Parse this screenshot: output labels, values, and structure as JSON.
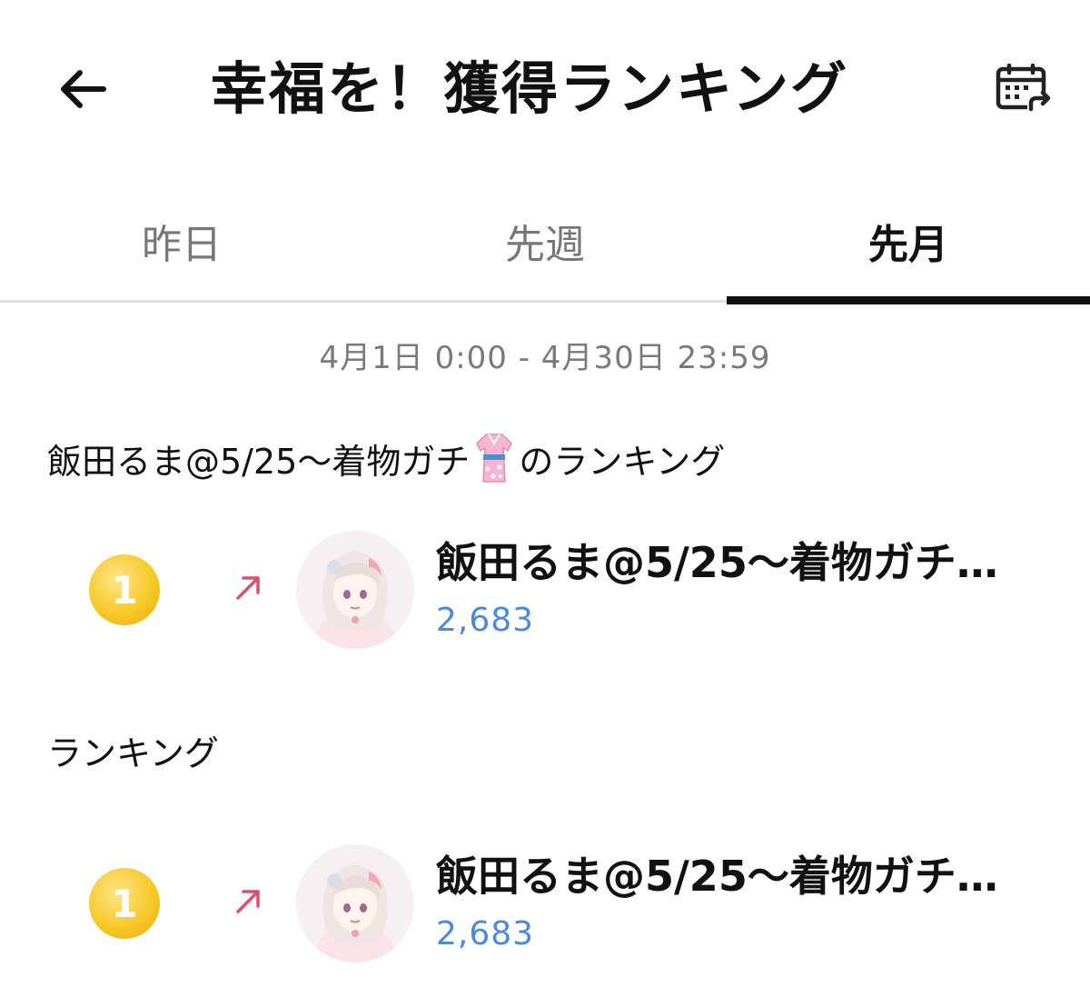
{
  "header": {
    "title": "幸福を！獲得ランキング",
    "back_icon": "arrow-left-icon",
    "calendar_icon": "calendar-share-icon"
  },
  "tabs": [
    {
      "label": "昨日",
      "active": false
    },
    {
      "label": "先週",
      "active": false
    },
    {
      "label": "先月",
      "active": true
    }
  ],
  "period": "4月1日 0:00 - 4月30日 23:59",
  "sections": [
    {
      "title_prefix": "飯田るま@5/25〜着物ガチ",
      "title_icon": "kimono-icon",
      "title_suffix": "のランキング",
      "rows": [
        {
          "rank": "1",
          "trend": "up-right-arrow-icon",
          "name": "飯田るま@5/25〜着物ガチ…",
          "score": "2,683"
        }
      ]
    },
    {
      "title_prefix": "ランキング",
      "rows": [
        {
          "rank": "1",
          "trend": "up-right-arrow-icon",
          "name": "飯田るま@5/25〜着物ガチ…",
          "score": "2,683"
        }
      ]
    }
  ],
  "colors": {
    "accent_score": "#4a8ad8",
    "medal_gold": "#f7c928",
    "trend_up": "#d9506a",
    "tab_active": "#111111",
    "tab_inactive": "#777777"
  }
}
